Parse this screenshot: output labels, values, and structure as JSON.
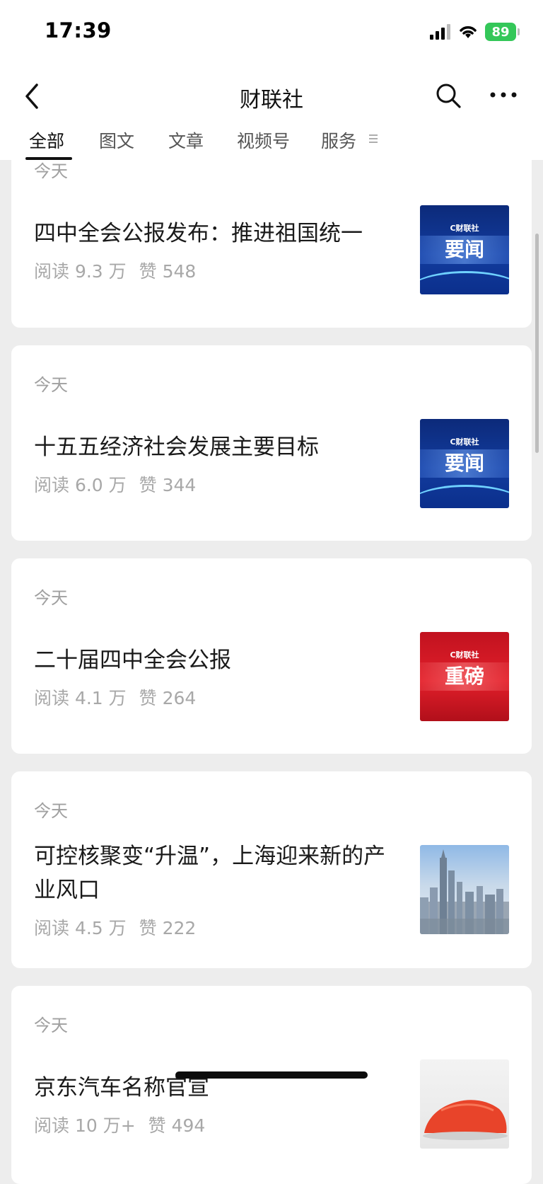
{
  "status_bar": {
    "time": "17:39",
    "battery": "89"
  },
  "header": {
    "title": "财联社"
  },
  "tabs": [
    {
      "label": "全部",
      "active": true
    },
    {
      "label": "图文",
      "active": false
    },
    {
      "label": "文章",
      "active": false
    },
    {
      "label": "视频号",
      "active": false
    },
    {
      "label": "服务",
      "active": false
    }
  ],
  "icons": [
    "back-chevron-icon",
    "search-icon",
    "more-icon",
    "menu-icon"
  ],
  "articles": [
    {
      "date": "今天",
      "title": "四中全会公报发布：推进祖国统一",
      "reads": "阅读 9.3 万",
      "likes": "赞 548",
      "thumb": {
        "type": "blue",
        "brand": "C财联社",
        "word": "要闻"
      }
    },
    {
      "date": "今天",
      "title": "十五五经济社会发展主要目标",
      "reads": "阅读 6.0 万",
      "likes": "赞 344",
      "thumb": {
        "type": "blue",
        "brand": "C财联社",
        "word": "要闻"
      }
    },
    {
      "date": "今天",
      "title": "二十届四中全会公报",
      "reads": "阅读 4.1 万",
      "likes": "赞 264",
      "thumb": {
        "type": "red",
        "brand": "C财联社",
        "word": "重磅"
      }
    },
    {
      "date": "今天",
      "title": "可控核聚变“升温”，上海迎来新的产业风口",
      "reads": "阅读 4.5 万",
      "likes": "赞 222",
      "thumb": {
        "type": "city"
      }
    },
    {
      "date": "今天",
      "title": "京东汽车名称官宣",
      "reads": "阅读 10 万+",
      "likes": "赞 494",
      "thumb": {
        "type": "car"
      }
    }
  ]
}
